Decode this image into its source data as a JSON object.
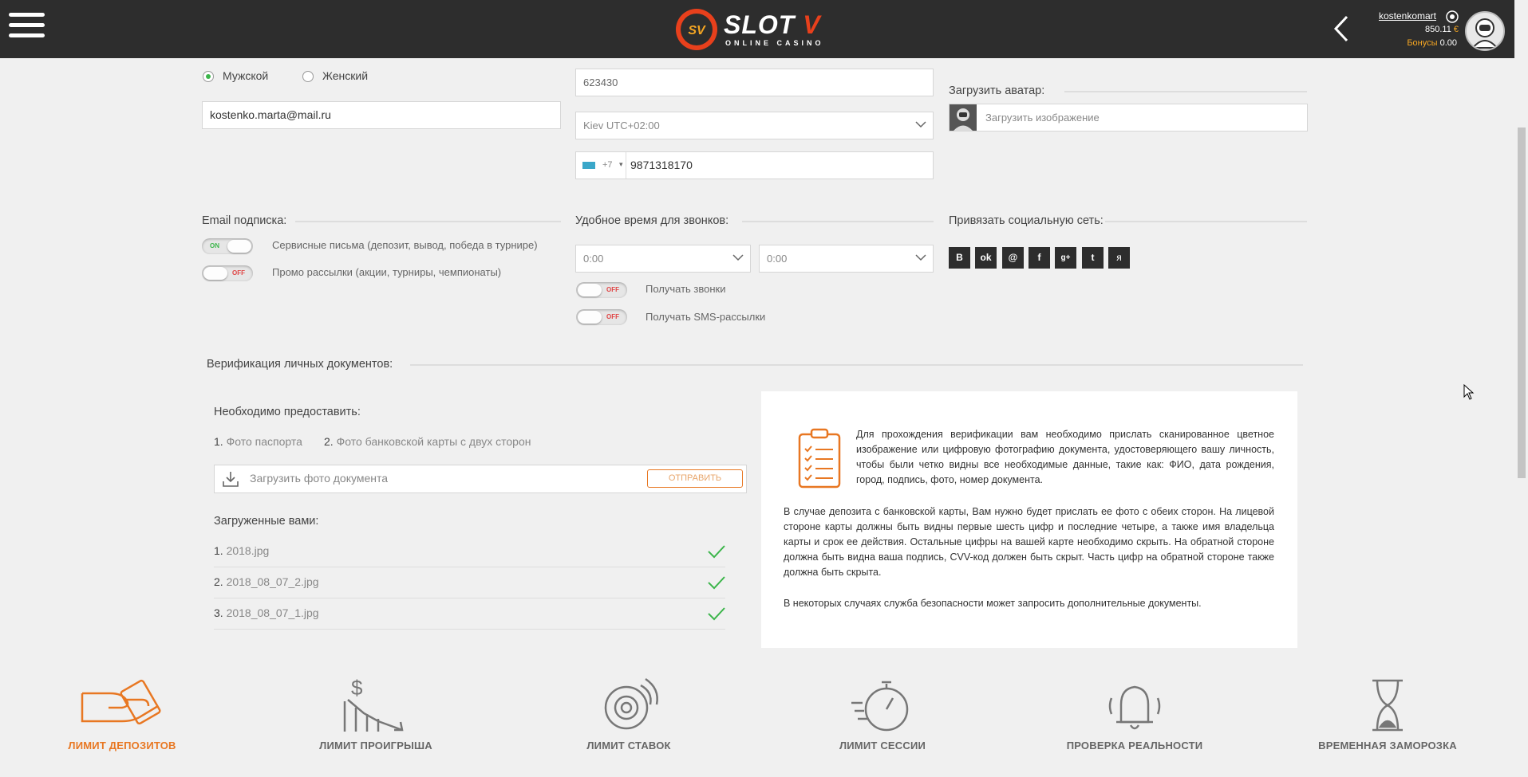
{
  "header": {
    "logo_main": "SLOT",
    "logo_letter": "V",
    "logo_badge": "SV",
    "logo_sub": "ONLINE CASINO",
    "username": "kostenkomart",
    "balance": "850.11",
    "currency": "€",
    "bonus_label": "Бонусы",
    "bonus_value": "0.00"
  },
  "profile": {
    "gender_male": "Мужской",
    "gender_female": "Женский",
    "email": "kostenko.marta@mail.ru",
    "postal_code": "623430",
    "timezone": "Kiev UTC+02:00",
    "phone_code": "+7",
    "phone": "9871318170",
    "avatar_label": "Загрузить аватар:",
    "avatar_placeholder": "Загрузить изображение"
  },
  "email_subscription": {
    "title": "Email подписка:",
    "items": [
      {
        "label": "Сервисные письма (депозит, вывод, победа в турнире)",
        "state": "on"
      },
      {
        "label": "Промо рассылки (акции, турниры, чемпионаты)",
        "state": "off"
      }
    ]
  },
  "call_time": {
    "title": "Удобное время для звонков:",
    "from": "0:00",
    "to": "0:00",
    "items": [
      {
        "label": "Получать звонки",
        "state": "off"
      },
      {
        "label": "Получать SMS-рассылки",
        "state": "off"
      }
    ]
  },
  "social": {
    "title": "Привязать социальную сеть:",
    "icons": [
      "vk-icon",
      "odnoklassniki-icon",
      "mailru-icon",
      "facebook-icon",
      "google-plus-icon",
      "twitter-icon",
      "yandex-icon"
    ]
  },
  "toggle_text": {
    "on": "ON",
    "off": "OFF"
  },
  "verification": {
    "title": "Верификация личных документов:",
    "required_title": "Необходимо предоставить:",
    "req1_num": "1.",
    "req1": "Фото паспорта",
    "req2_num": "2.",
    "req2": "Фото банковской карты с двух сторон",
    "upload_placeholder": "Загрузить фото документа",
    "send_button": "ОТПРАВИТЬ",
    "uploaded_title": "Загруженные вами:",
    "files": [
      {
        "num": "1.",
        "name": "2018.jpg"
      },
      {
        "num": "2.",
        "name": "2018_08_07_2.jpg"
      },
      {
        "num": "3.",
        "name": "2018_08_07_1.jpg"
      }
    ],
    "info_p1": "Для прохождения верификации вам необходимо прислать сканированное цветное изображение или цифровую фотографию документа, удостоверяющего вашу личность, чтобы были четко видны все необходимые данные, такие как: ФИО, дата рождения, город, подпись, фото, номер документа.",
    "info_p2": "В случае депозита с банковской карты, Вам нужно будет прислать ее фото с обеих сторон. На лицевой стороне карты должны быть видны первые шесть цифр и последние четыре, а также имя владельца карты и срок ее действия. Остальные цифры на вашей карте необходимо скрыть. На обратной стороне должна быть видна ваша подпись, CVV-код должен быть скрыт. Часть цифр на обратной стороне также должна быть скрыта.",
    "info_p3": "В некоторых случаях служба безопасности может запросить дополнительные документы."
  },
  "limits": [
    {
      "label": "ЛИМИТ ДЕПОЗИТОВ",
      "icon": "hand-card-icon",
      "active": true
    },
    {
      "label": "ЛИМИТ ПРОИГРЫША",
      "icon": "loss-chart-icon",
      "active": false
    },
    {
      "label": "ЛИМИТ СТАВОК",
      "icon": "chips-icon",
      "active": false
    },
    {
      "label": "ЛИМИТ СЕССИИ",
      "icon": "stopwatch-icon",
      "active": false
    },
    {
      "label": "ПРОВЕРКА РЕАЛЬНОСТИ",
      "icon": "bell-icon",
      "active": false
    },
    {
      "label": "ВРЕМЕННАЯ ЗАМОРОЗКА",
      "icon": "hourglass-icon",
      "active": false
    }
  ],
  "colors": {
    "accent": "#e87722",
    "header_bg": "#2d2d2d",
    "check_green": "#3bb54a",
    "toggle_off_red": "#e04545"
  }
}
